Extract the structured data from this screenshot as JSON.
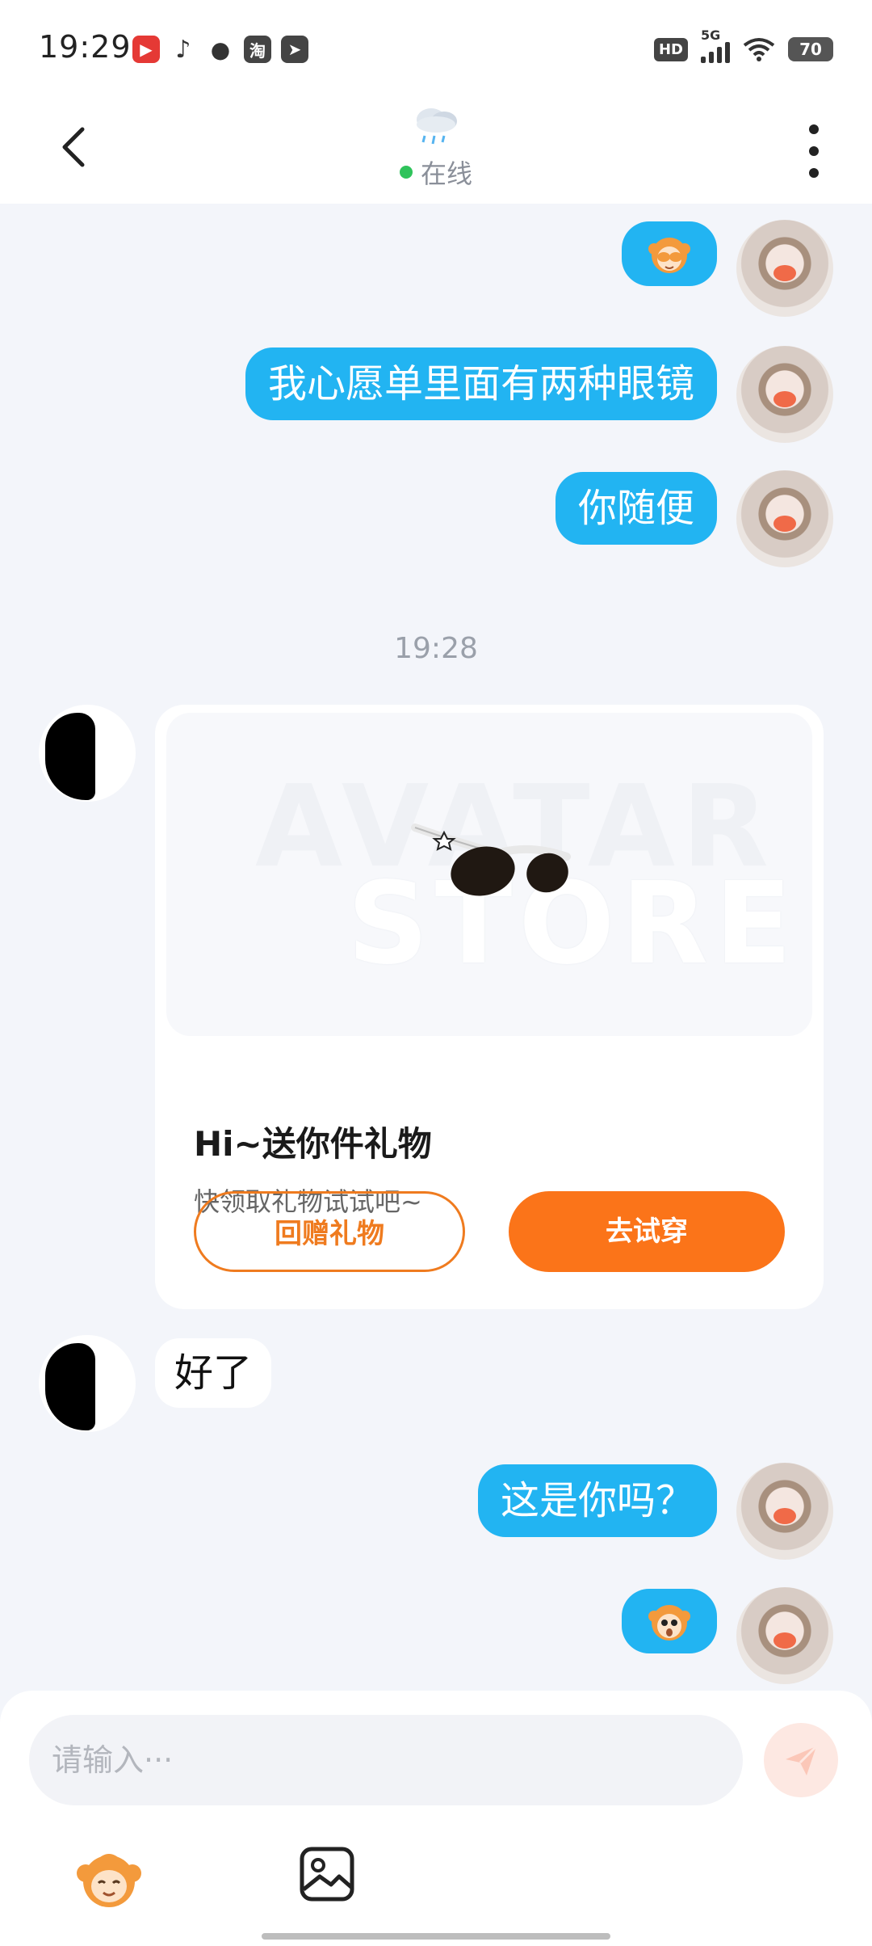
{
  "status_bar": {
    "time": "19:29",
    "apps": [
      "video",
      "douyin",
      "wechat",
      "淘",
      "send"
    ],
    "network": "5G",
    "hd": "HD",
    "battery": "70"
  },
  "header": {
    "weather_icon": "rain-cloud-icon",
    "status": "在线",
    "status_color": "#2fc35b"
  },
  "messages": [
    {
      "from": "me",
      "type": "emoji",
      "emoji": "monkey-covering-face-icon"
    },
    {
      "from": "me",
      "type": "text",
      "text": "我心愿单里面有两种眼镜"
    },
    {
      "from": "me",
      "type": "text",
      "text": "你随便"
    },
    {
      "type": "timestamp",
      "text": "19:28"
    },
    {
      "from": "other",
      "type": "gift_card",
      "watermark_top": "AVATAR",
      "watermark_bottom": "STORE",
      "title": "Hi~送你件礼物",
      "subtitle": "快领取礼物试试吧~",
      "button_return": "回赠礼物",
      "button_try": "去试穿"
    },
    {
      "from": "other",
      "type": "text",
      "text": "好了"
    },
    {
      "from": "me",
      "type": "text",
      "text": "这是你吗？"
    },
    {
      "from": "me",
      "type": "emoji",
      "emoji": "monkey-surprised-icon"
    }
  ],
  "input": {
    "placeholder": "请输入···",
    "send_icon": "send-icon"
  },
  "toolbar": {
    "sticker_icon": "monkey-sticker-icon",
    "image_icon": "image-icon"
  },
  "colors": {
    "bubble_me": "#22b4f2",
    "accent_orange": "#fb7419",
    "background": "#f3f5fa"
  }
}
